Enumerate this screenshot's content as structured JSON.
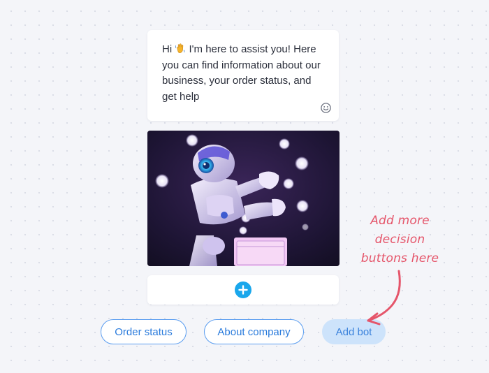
{
  "message": {
    "greeting": "Hi",
    "emoji_icon": "waving-hand-icon",
    "text": "I'm here to assist you! Here you can find information about our business, your order status, and get help",
    "emoji_button_icon": "smiley-face-icon"
  },
  "image": {
    "subject_icon": "robot-image"
  },
  "add_row": {
    "icon": "plus-circle-icon",
    "color": "#1aa7ec"
  },
  "decision_buttons": [
    {
      "label": "Order status"
    },
    {
      "label": "About company"
    },
    {
      "label": "Add bot"
    }
  ],
  "annotation": {
    "lines": [
      "Add more",
      "decision",
      "buttons here"
    ],
    "color": "#e5556a"
  },
  "colors": {
    "button_border": "#5a9df0",
    "button_text": "#2a7bdc",
    "active_button_bg": "#cde3fb"
  }
}
